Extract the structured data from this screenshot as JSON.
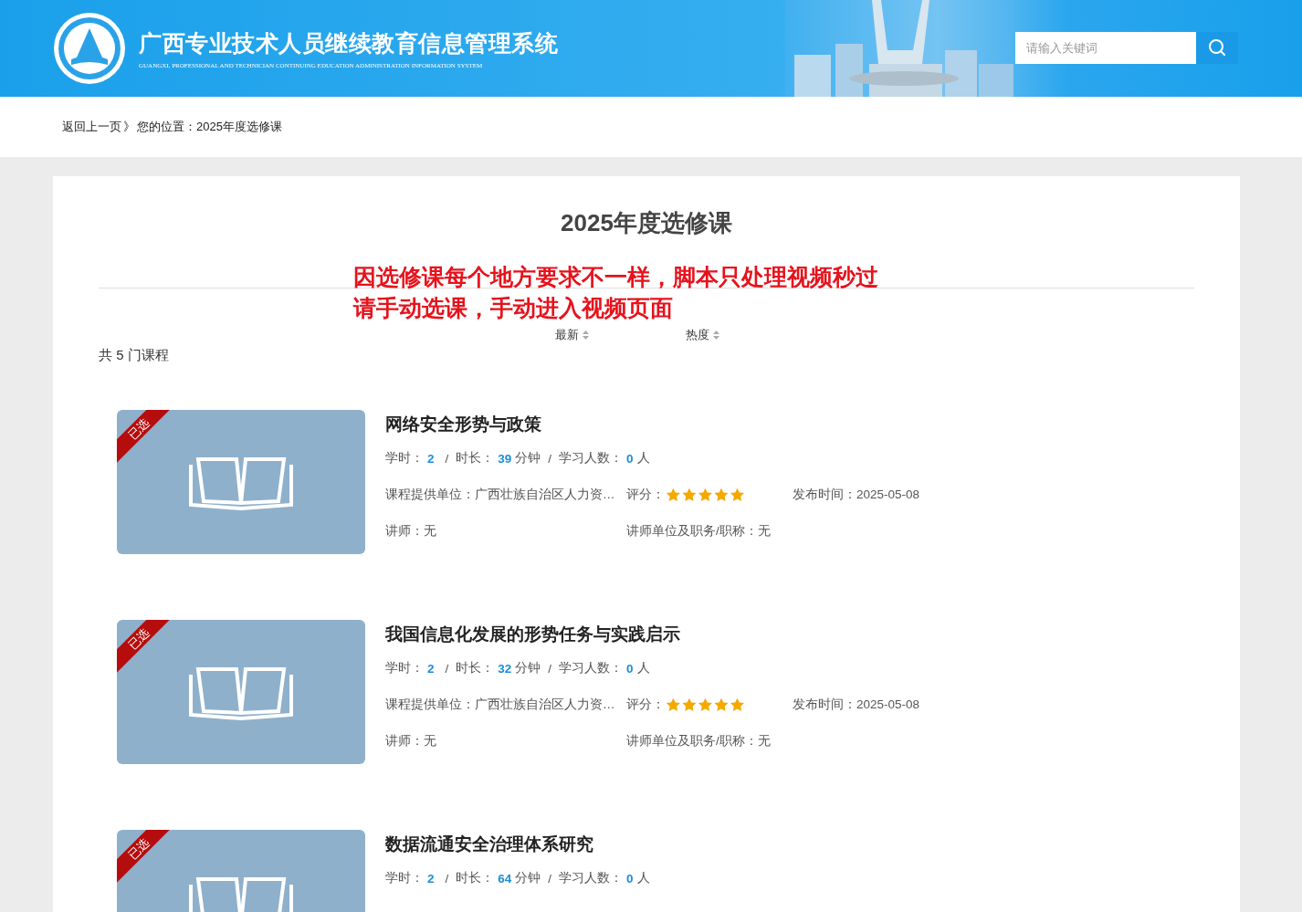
{
  "header": {
    "title": "广西专业技术人员继续教育信息管理系统",
    "subtitle": "GUANGXI, PROFESSIONAL AND TECHNICIAN CONTINUING EDUCATION ADMINISTRATION INFORMATION SYSTEM",
    "search": {
      "placeholder": "请输入关键词"
    }
  },
  "breadcrumb": {
    "back": "返回上一页",
    "separator": "》",
    "location": "您的位置：2025年度选修课"
  },
  "page_title": "2025年度选修课",
  "annotation": [
    "因选修课每个地方要求不一样，脚本只处理视频秒过",
    "请手动选课，手动进入视频页面"
  ],
  "sort_options": [
    {
      "label": "最新"
    },
    {
      "label": "热度"
    }
  ],
  "count": "共 5 门课程",
  "courses": [
    {
      "badge": "已选",
      "title": "网络安全形势与政策",
      "stats": [
        {
          "label": "学时：",
          "value": "2"
        },
        {
          "sep": "/",
          "label": "时长：",
          "value": "39",
          "unit": "分钟"
        },
        {
          "sep": "/",
          "label": "学习人数：",
          "value": "0",
          "unit": "人"
        }
      ],
      "provider": "课程提供单位：广西壮族自治区人力资…",
      "rating_label": "评分：",
      "stars": 5,
      "published": "发布时间：2025-05-08",
      "lecturer": "讲师：无",
      "lecturer_unit": "讲师单位及职务/职称：无"
    },
    {
      "badge": "已选",
      "title": "我国信息化发展的形势任务与实践启示",
      "stats": [
        {
          "label": "学时：",
          "value": "2"
        },
        {
          "sep": "/",
          "label": "时长：",
          "value": "32",
          "unit": "分钟"
        },
        {
          "sep": "/",
          "label": "学习人数：",
          "value": "0",
          "unit": "人"
        }
      ],
      "provider": "课程提供单位：广西壮族自治区人力资…",
      "rating_label": "评分：",
      "stars": 5,
      "published": "发布时间：2025-05-08",
      "lecturer": "讲师：无",
      "lecturer_unit": "讲师单位及职务/职称：无"
    },
    {
      "badge": "已选",
      "title": "数据流通安全治理体系研究",
      "stats": [
        {
          "label": "学时：",
          "value": "2"
        },
        {
          "sep": "/",
          "label": "时长：",
          "value": "64",
          "unit": "分钟"
        },
        {
          "sep": "/",
          "label": "学习人数：",
          "value": "0",
          "unit": "人"
        }
      ]
    }
  ]
}
